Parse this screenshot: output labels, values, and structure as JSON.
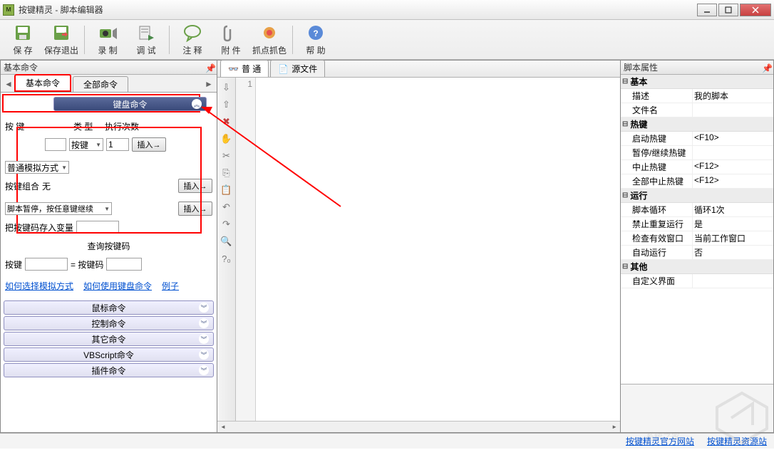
{
  "window": {
    "title": "按键精灵 - 脚本编辑器"
  },
  "toolbar": {
    "save": "保 存",
    "save_exit": "保存退出",
    "record": "录 制",
    "debug": "调 试",
    "comment": "注 释",
    "attach": "附 件",
    "grab": "抓点抓色",
    "help": "帮 助"
  },
  "left": {
    "title": "基本命令",
    "tab_basic": "基本命令",
    "tab_all": "全部命令",
    "sections": {
      "keyboard": "键盘命令",
      "mouse": "鼠标命令",
      "control": "控制命令",
      "misc": "其它命令",
      "vbs": "VBScript命令",
      "plugin": "插件命令"
    },
    "kb": {
      "key_label": "按 键",
      "type_label": "类 型",
      "count_label": "执行次数",
      "type_value": "按键",
      "count_value": "1",
      "sim_label": "普通模拟方式",
      "combo_label": "按键组合",
      "combo_value": "无",
      "pause_label": "脚本暂停，按任意键继续",
      "savevar_label": "把按键码存入变量",
      "query_label": "查询按键码",
      "query_key": "按键",
      "query_eq": "= 按键码",
      "insert": "插入→",
      "link_sim": "如何选择模拟方式",
      "link_kb": "如何使用键盘命令",
      "link_ex": "例子"
    }
  },
  "editor": {
    "tab_normal": "普 通",
    "tab_source": "源文件",
    "line1": "1"
  },
  "props": {
    "title": "脚本属性",
    "cat_basic": "基本",
    "desc_k": "描述",
    "desc_v": "我的脚本",
    "file_k": "文件名",
    "cat_hotkey": "热键",
    "start_k": "启动热键",
    "start_v": "<F10>",
    "pause_k": "暂停/继续热键",
    "stop_k": "中止热键",
    "stop_v": "<F12>",
    "allstop_k": "全部中止热键",
    "allstop_v": "<F12>",
    "cat_run": "运行",
    "loop_k": "脚本循环",
    "loop_v": "循环1次",
    "norepeat_k": "禁止重复运行",
    "norepeat_v": "是",
    "checkwin_k": "检查有效窗口",
    "checkwin_v": "当前工作窗口",
    "autorun_k": "自动运行",
    "autorun_v": "否",
    "cat_other": "其他",
    "custom_k": "自定义界面"
  },
  "footer": {
    "official": "按键精灵官方网站",
    "resource": "按键精灵资源站"
  }
}
